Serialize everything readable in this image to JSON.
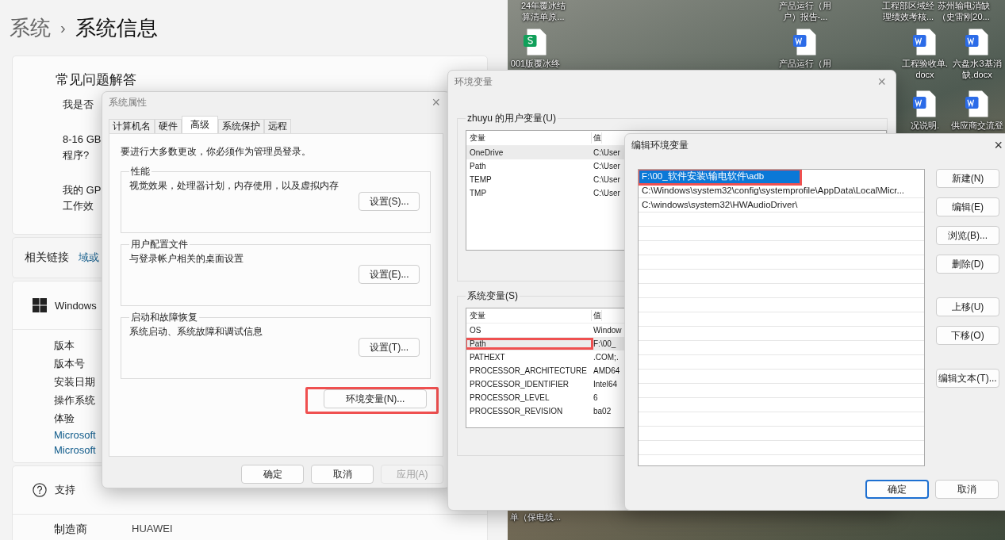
{
  "settings": {
    "breadcrumb": {
      "parent": "系统",
      "separator": "›",
      "current": "系统信息"
    },
    "faq": {
      "title": "常见问题解答",
      "questions": [
        {
          "lines": [
            "我是否"
          ]
        },
        {
          "lines": [
            "8-16 GB",
            "程序?"
          ]
        },
        {
          "lines": [
            "我的 GP",
            "工作效"
          ]
        }
      ]
    },
    "related": {
      "label": "相关链接",
      "links": [
        "域或"
      ]
    },
    "about": {
      "title": "Windows",
      "rows": [
        {
          "kind": "label",
          "text": "版本"
        },
        {
          "kind": "label",
          "text": "版本号"
        },
        {
          "kind": "label",
          "text": "安装日期"
        },
        {
          "kind": "label",
          "text": "操作系统"
        },
        {
          "kind": "label",
          "text": "体验"
        },
        {
          "kind": "link",
          "text": "Microsoft"
        },
        {
          "kind": "link",
          "text": "Microsoft"
        }
      ]
    },
    "support": {
      "title": "支持",
      "rows": [
        {
          "label": "制造商",
          "value": "HUAWEI"
        }
      ]
    }
  },
  "desktop": {
    "items": [
      {
        "kind": "none",
        "lines": [
          "24年覆冰结",
          "算清单原..."
        ]
      },
      {
        "kind": "none",
        "lines": [
          "产品运行（用",
          "户）报告-..."
        ]
      },
      {
        "kind": "none",
        "lines": [
          "工程部区域经",
          "理绩效考核..."
        ]
      },
      {
        "kind": "none",
        "lines": [
          "苏州输电消缺",
          "（史雷刚20..."
        ]
      },
      {
        "kind": "sheet",
        "lines": [
          "001版覆冰终"
        ]
      },
      {
        "kind": "word",
        "lines": [
          "产品运行（用"
        ]
      },
      {
        "kind": "word",
        "lines": [
          "工程验收单.",
          "docx"
        ]
      },
      {
        "kind": "word",
        "lines": [
          "六盘水3基消",
          "缺.docx"
        ]
      },
      {
        "kind": "word",
        "lines": [
          "况说明."
        ]
      },
      {
        "kind": "word",
        "lines": [
          "供应商交流登"
        ]
      },
      {
        "kind": "none",
        "lines": [
          "单（保电线..."
        ]
      }
    ]
  },
  "system_properties": {
    "title": "系统属性",
    "close": "×",
    "tabs": [
      {
        "label": "计算机名",
        "selected": false
      },
      {
        "label": "硬件",
        "selected": false
      },
      {
        "label": "高级",
        "selected": true
      },
      {
        "label": "系统保护",
        "selected": false
      },
      {
        "label": "远程",
        "selected": false
      }
    ],
    "notice": "要进行大多数更改，你必须作为管理员登录。",
    "groups": [
      {
        "title": "性能",
        "description": "视觉效果，处理器计划，内存使用，以及虚拟内存",
        "button": "设置(S)..."
      },
      {
        "title": "用户配置文件",
        "description": "与登录帐户相关的桌面设置",
        "button": "设置(E)..."
      },
      {
        "title": "启动和故障恢复",
        "description": "系统启动、系统故障和调试信息",
        "button": "设置(T)..."
      }
    ],
    "env_button": {
      "label": "环境变量(N)...",
      "highlighted": true
    },
    "buttons": [
      {
        "label": "确定",
        "disabled": false
      },
      {
        "label": "取消",
        "disabled": false
      },
      {
        "label": "应用(A)",
        "disabled": true
      }
    ]
  },
  "environment_variables": {
    "title": "环境变量",
    "close": "×",
    "user_group": {
      "title": "zhuyu 的用户变量(U)",
      "columns": [
        "变量",
        "值"
      ],
      "rows": [
        {
          "name": "OneDrive",
          "value": "C:\\User",
          "selected": true,
          "highlighted": false
        },
        {
          "name": "Path",
          "value": "C:\\User",
          "selected": false,
          "highlighted": false
        },
        {
          "name": "TEMP",
          "value": "C:\\User",
          "selected": false,
          "highlighted": false
        },
        {
          "name": "TMP",
          "value": "C:\\User",
          "selected": false,
          "highlighted": false
        }
      ]
    },
    "system_group": {
      "title": "系统变量(S)",
      "columns": [
        "变量",
        "值"
      ],
      "rows": [
        {
          "name": "OS",
          "value": "Window",
          "selected": false,
          "highlighted": false
        },
        {
          "name": "Path",
          "value": "F:\\00_",
          "selected": true,
          "highlighted": true
        },
        {
          "name": "PATHEXT",
          "value": ".COM;.",
          "selected": false,
          "highlighted": false
        },
        {
          "name": "PROCESSOR_ARCHITECTURE",
          "value": "AMD64",
          "selected": false,
          "highlighted": false
        },
        {
          "name": "PROCESSOR_IDENTIFIER",
          "value": "Intel64",
          "selected": false,
          "highlighted": false
        },
        {
          "name": "PROCESSOR_LEVEL",
          "value": "6",
          "selected": false,
          "highlighted": false
        },
        {
          "name": "PROCESSOR_REVISION",
          "value": "ba02",
          "selected": false,
          "highlighted": false
        }
      ]
    }
  },
  "edit_variable": {
    "title": "编辑环境变量",
    "close": "×",
    "entries": [
      {
        "text": "F:\\00_软件安装\\输电软件\\adb",
        "selected": true,
        "highlighted": true
      },
      {
        "text": "C:\\Windows\\system32\\config\\systemprofile\\AppData\\Local\\Micr...",
        "selected": false,
        "highlighted": false
      },
      {
        "text": "C:\\windows\\system32\\HWAudioDriver\\",
        "selected": false,
        "highlighted": false
      }
    ],
    "side_buttons": [
      [
        "新建(N)",
        "编辑(E)",
        "浏览(B)...",
        "删除(D)"
      ],
      [
        "上移(U)",
        "下移(O)"
      ],
      [
        "编辑文本(T)..."
      ]
    ],
    "buttons": [
      {
        "label": "确定",
        "default": true
      },
      {
        "label": "取消",
        "default": false
      }
    ]
  }
}
